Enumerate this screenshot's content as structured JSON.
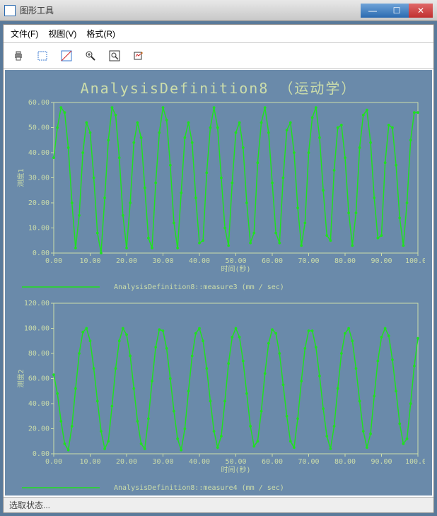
{
  "window": {
    "title": "图形工具"
  },
  "menu": {
    "file": "文件(F)",
    "view": "视图(V)",
    "format": "格式(R)"
  },
  "toolbar": {
    "print": "print-icon",
    "select": "select-icon",
    "pan": "pan-icon",
    "zoom_in": "zoom-in-icon",
    "zoom_fit": "zoom-fit-icon",
    "options": "options-icon"
  },
  "status": {
    "text": "选取状态..."
  },
  "chart_data": [
    {
      "type": "line",
      "title": "AnalysisDefinition8 （运动学）",
      "xlabel": "时间(秒)",
      "ylabel": "测度1",
      "series_label": "AnalysisDefinition8::measure3 (mm / sec)",
      "xlim": [
        0,
        100
      ],
      "ylim": [
        0,
        60
      ],
      "xticks": [
        0,
        10,
        20,
        30,
        40,
        50,
        60,
        70,
        80,
        90,
        100
      ],
      "yticks": [
        0,
        10,
        20,
        30,
        40,
        50,
        60
      ],
      "x": [
        0,
        1,
        2,
        3,
        4,
        5,
        6,
        7,
        8,
        9,
        10,
        11,
        12,
        13,
        14,
        15,
        16,
        17,
        18,
        19,
        20,
        21,
        22,
        23,
        24,
        25,
        26,
        27,
        28,
        29,
        30,
        31,
        32,
        33,
        34,
        35,
        36,
        37,
        38,
        39,
        40,
        41,
        42,
        43,
        44,
        45,
        46,
        47,
        48,
        49,
        50,
        51,
        52,
        53,
        54,
        55,
        56,
        57,
        58,
        59,
        60,
        61,
        62,
        63,
        64,
        65,
        66,
        67,
        68,
        69,
        70,
        71,
        72,
        73,
        74,
        75,
        76,
        77,
        78,
        79,
        80,
        81,
        82,
        83,
        84,
        85,
        86,
        87,
        88,
        89,
        90,
        91,
        92,
        93,
        94,
        95,
        96,
        97,
        98,
        99,
        100
      ],
      "y": [
        38,
        50,
        58,
        56,
        42,
        20,
        2,
        15,
        40,
        52,
        48,
        30,
        8,
        0,
        22,
        45,
        58,
        55,
        38,
        15,
        2,
        20,
        44,
        52,
        46,
        26,
        6,
        2,
        28,
        48,
        58,
        53,
        35,
        12,
        2,
        24,
        46,
        52,
        44,
        22,
        4,
        5,
        32,
        50,
        58,
        50,
        30,
        10,
        3,
        28,
        48,
        52,
        42,
        20,
        4,
        8,
        36,
        52,
        58,
        48,
        28,
        8,
        4,
        30,
        49,
        52,
        40,
        18,
        3,
        12,
        40,
        54,
        58,
        46,
        25,
        7,
        5,
        33,
        50,
        51,
        38,
        16,
        3,
        16,
        42,
        55,
        57,
        44,
        22,
        6,
        7,
        36,
        51,
        50,
        35,
        14,
        3,
        20,
        45,
        56,
        56
      ]
    },
    {
      "type": "line",
      "xlabel": "时间(秒)",
      "ylabel": "测度2",
      "series_label": "AnalysisDefinition8::measure4 (mm / sec)",
      "xlim": [
        0,
        100
      ],
      "ylim": [
        0,
        120
      ],
      "xticks": [
        0,
        10,
        20,
        30,
        40,
        50,
        60,
        70,
        80,
        90,
        100
      ],
      "yticks": [
        0,
        20,
        40,
        60,
        80,
        100,
        120
      ],
      "x": [
        0,
        1,
        2,
        3,
        4,
        5,
        6,
        7,
        8,
        9,
        10,
        11,
        12,
        13,
        14,
        15,
        16,
        17,
        18,
        19,
        20,
        21,
        22,
        23,
        24,
        25,
        26,
        27,
        28,
        29,
        30,
        31,
        32,
        33,
        34,
        35,
        36,
        37,
        38,
        39,
        40,
        41,
        42,
        43,
        44,
        45,
        46,
        47,
        48,
        49,
        50,
        51,
        52,
        53,
        54,
        55,
        56,
        57,
        58,
        59,
        60,
        61,
        62,
        63,
        64,
        65,
        66,
        67,
        68,
        69,
        70,
        71,
        72,
        73,
        74,
        75,
        76,
        77,
        78,
        79,
        80,
        81,
        82,
        83,
        84,
        85,
        86,
        87,
        88,
        89,
        90,
        91,
        92,
        93,
        94,
        95,
        96,
        97,
        98,
        99,
        100
      ],
      "y": [
        63,
        48,
        26,
        8,
        3,
        22,
        52,
        80,
        97,
        100,
        90,
        68,
        42,
        18,
        4,
        10,
        38,
        68,
        90,
        100,
        95,
        78,
        52,
        26,
        8,
        4,
        28,
        58,
        85,
        99,
        98,
        84,
        60,
        34,
        12,
        3,
        20,
        50,
        78,
        96,
        100,
        90,
        68,
        42,
        18,
        5,
        14,
        42,
        72,
        93,
        100,
        93,
        74,
        48,
        22,
        6,
        10,
        34,
        64,
        88,
        99,
        96,
        80,
        55,
        30,
        10,
        5,
        28,
        58,
        84,
        98,
        98,
        85,
        62,
        36,
        14,
        4,
        22,
        52,
        80,
        96,
        100,
        90,
        68,
        42,
        18,
        5,
        16,
        46,
        74,
        93,
        100,
        94,
        75,
        50,
        24,
        8,
        12,
        40,
        70,
        92
      ]
    }
  ]
}
